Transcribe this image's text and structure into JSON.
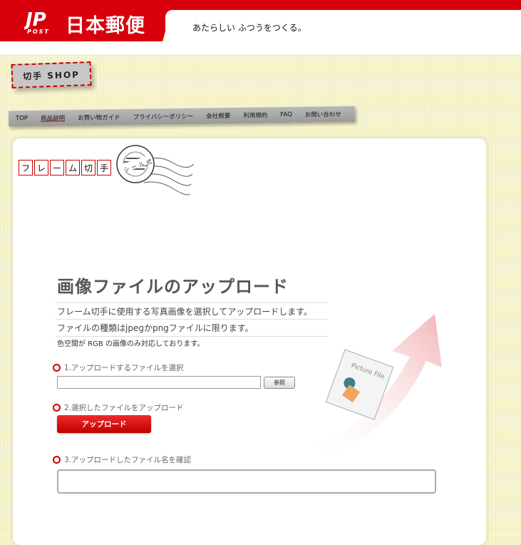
{
  "header": {
    "brand_logo_text": "JP",
    "brand_logo_sub": "POST",
    "brand_name": "日本郵便",
    "tagline": "あたらしい ふつうをつくる。"
  },
  "shop_badge": "切手 SHOP",
  "nav": [
    {
      "label": "TOP"
    },
    {
      "label": "商品説明",
      "active": true
    },
    {
      "label": "お買い物ガイド"
    },
    {
      "label": "プライバシーポリシー"
    },
    {
      "label": "会社概要"
    },
    {
      "label": "利用規約"
    },
    {
      "label": "FAQ"
    },
    {
      "label": "お問い合わせ"
    }
  ],
  "frame_title": [
    "フ",
    "レ",
    "ー",
    "ム",
    "切",
    "手"
  ],
  "seal_text": "シール式",
  "main": {
    "title": "画像ファイルのアップロード",
    "description_1": "フレーム切手に使用する写真画像を選択してアップロードします。",
    "description_2": "ファイルの種類はjpegかpngファイルに限ります。",
    "description_3": "色空間が RGB の画像のみ対応しております。",
    "step1_label": "1.アップロードするファイルを選択",
    "browse_label": "参照",
    "step2_label": "2.選択したファイルをアップロード",
    "upload_label": "アップロード",
    "step3_label": "3.アップロードしたファイル名を確認",
    "picture_file_label": "Picture File"
  },
  "colors": {
    "accent": "#d8000c",
    "background": "#f4f1c8"
  }
}
